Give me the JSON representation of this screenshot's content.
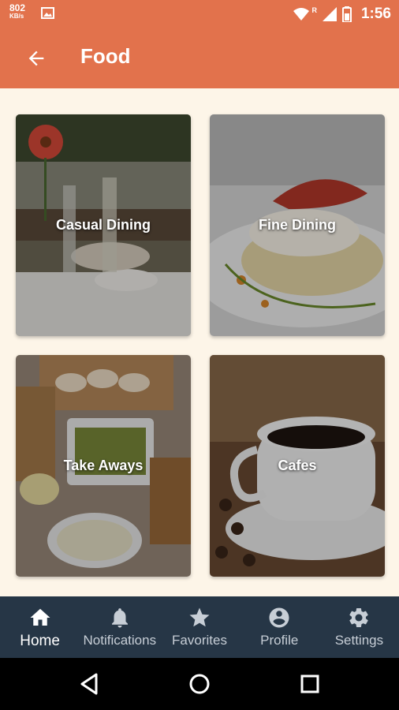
{
  "status_bar": {
    "speed_value": "802",
    "speed_unit": "KB/s",
    "time": "1:56",
    "network_badge": "R"
  },
  "app_bar": {
    "title": "Food",
    "back_icon": "arrow-back-icon"
  },
  "categories": [
    {
      "label": "Casual Dining"
    },
    {
      "label": "Fine Dining"
    },
    {
      "label": "Take Aways"
    },
    {
      "label": "Cafes"
    }
  ],
  "bottom_nav": {
    "active": "Home",
    "items": [
      {
        "label": "Home",
        "icon": "home-icon"
      },
      {
        "label": "Notifications",
        "icon": "bell-icon"
      },
      {
        "label": "Favorites",
        "icon": "star-icon"
      },
      {
        "label": "Profile",
        "icon": "profile-icon"
      },
      {
        "label": "Settings",
        "icon": "gear-icon"
      }
    ]
  },
  "colors": {
    "app_bar": "#e2724c",
    "background": "#fdf5e8",
    "bottom_nav": "#263646",
    "nav_inactive": "#c7ced6",
    "nav_active": "#ffffff"
  }
}
